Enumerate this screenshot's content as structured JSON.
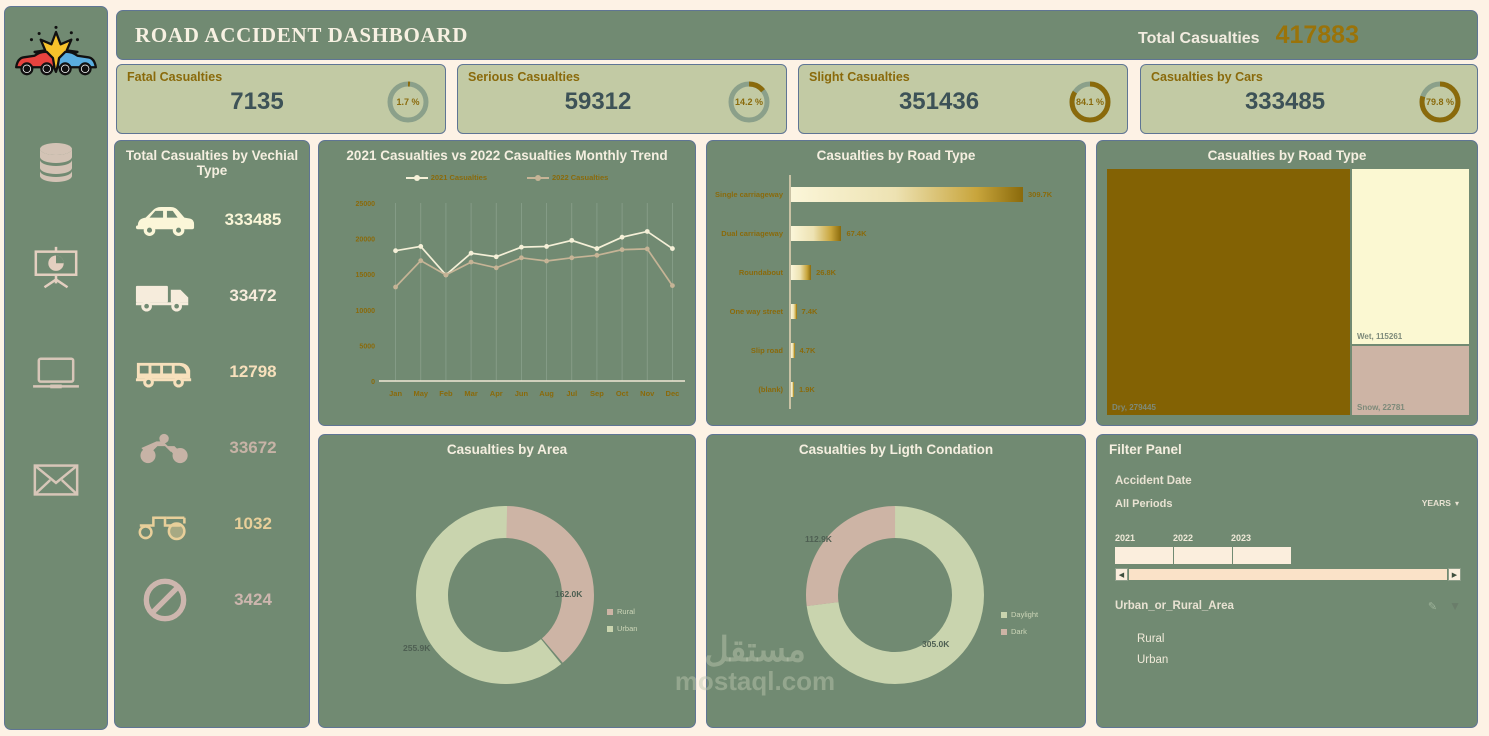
{
  "header": {
    "title": "ROAD ACCIDENT DASHBOARD",
    "total_label": "Total Casualties",
    "total_value": "417883"
  },
  "sidebar": {
    "icons": [
      {
        "name": "car-crash-logo",
        "label": "car-crash-logo"
      },
      {
        "name": "database-icon",
        "label": "database-icon"
      },
      {
        "name": "presentation-chart-icon",
        "label": "presentation-chart-icon"
      },
      {
        "name": "laptop-icon",
        "label": "laptop-icon"
      },
      {
        "name": "envelope-icon",
        "label": "envelope-icon"
      }
    ]
  },
  "kpis": [
    {
      "title": "Fatal Casualties",
      "value": "7135",
      "pct_label": "1.7 %",
      "pct": 1.7
    },
    {
      "title": "Serious Casualties",
      "value": "59312",
      "pct_label": "14.2 %",
      "pct": 14.2
    },
    {
      "title": "Slight Casualties",
      "value": "351436",
      "pct_label": "84.1 %",
      "pct": 84.1
    },
    {
      "title": "Casualties by Cars",
      "value": "333485",
      "pct_label": "79.8 %",
      "pct": 79.8
    }
  ],
  "vehicle_panel": {
    "title": "Total Casualties by Vechial Type",
    "rows": [
      {
        "icon": "car-icon",
        "value": "333485",
        "color": "#fbf6d8"
      },
      {
        "icon": "truck-icon",
        "value": "33472",
        "color": "#f6ecdc"
      },
      {
        "icon": "bus-icon",
        "value": "12798",
        "color": "#f7e0bc"
      },
      {
        "icon": "motorcycle-icon",
        "value": "33672",
        "color": "#c7b3a6"
      },
      {
        "icon": "tractor-icon",
        "value": "1032",
        "color": "#e8cf9a"
      },
      {
        "icon": "no-entry-icon",
        "value": "3424",
        "color": "#cdb6ae"
      }
    ]
  },
  "chart_data": [
    {
      "id": "monthly-trend",
      "type": "line",
      "title": "2021 Casualties vs 2022 Casualties Monthly Trend",
      "categories": [
        "Jan",
        "May",
        "Feb",
        "Mar",
        "Apr",
        "Jun",
        "Aug",
        "Jul",
        "Sep",
        "Oct",
        "Nov",
        "Dec"
      ],
      "series": [
        {
          "name": "2021 Casualties",
          "color": "#f5f0d8",
          "values": [
            18300,
            18900,
            14900,
            17950,
            17450,
            18800,
            18900,
            19750,
            18600,
            20200,
            21000,
            18600
          ]
        },
        {
          "name": "2022 Casualties",
          "color": "#c6b496",
          "values": [
            13200,
            16900,
            14900,
            16700,
            15900,
            17300,
            16850,
            17300,
            17650,
            18450,
            18550,
            13400
          ]
        }
      ],
      "ylabel": "",
      "xlabel": "",
      "yticks": [
        0,
        5000,
        10000,
        15000,
        20000,
        25000
      ],
      "ylim": [
        0,
        25000
      ],
      "grid": true,
      "legend_position": "top"
    },
    {
      "id": "road-type-bars",
      "type": "bar",
      "orientation": "horizontal",
      "title": "Casualties by Road Type",
      "categories": [
        "Single carriageway",
        "Dual carriageway",
        "Roundabout",
        "One way street",
        "Slip road",
        "(blank)"
      ],
      "values": [
        309700,
        67400,
        26800,
        7400,
        4700,
        1900
      ],
      "value_labels": [
        "309.7K",
        "67.4K",
        "26.8K",
        "7.4K",
        "4.7K",
        "1.9K"
      ],
      "xlim": [
        0,
        309700
      ],
      "grid": false
    },
    {
      "id": "road-surface-treemap",
      "type": "treemap",
      "title": "Casualties by Road Type",
      "categories": [
        "Dry",
        "Wet",
        "Snow"
      ],
      "values": [
        279445,
        115261,
        22781
      ],
      "labels": [
        "Dry, 279445",
        "Wet, 115261",
        "Snow, 22781"
      ],
      "colors": [
        "#836204",
        "#fbf8d2",
        "#cdb4a5"
      ]
    },
    {
      "id": "area-donut",
      "type": "pie",
      "title": "Casualties by Area",
      "categories": [
        "Rural",
        "Urban"
      ],
      "values": [
        162000,
        255900
      ],
      "value_labels": [
        "162.0K",
        "255.9K"
      ],
      "colors": [
        "#cdb4a5",
        "#c9d4ae"
      ],
      "legend_position": "right"
    },
    {
      "id": "light-donut",
      "type": "pie",
      "title": "Casualties by Ligth Condation",
      "categories": [
        "Daylight",
        "Dark"
      ],
      "values": [
        305000,
        112900
      ],
      "value_labels": [
        "305.0K",
        "112.9K"
      ],
      "colors": [
        "#c9d4ae",
        "#cdb4a5"
      ],
      "legend_position": "right"
    }
  ],
  "filter_panel": {
    "title": "Filter Panel",
    "date_label": "Accident Date",
    "period_label": "All Periods",
    "granularity": "YEARS",
    "years": [
      "2021",
      "2022",
      "2023"
    ],
    "field_label": "Urban_or_Rural_Area",
    "options": [
      "Rural",
      "Urban"
    ]
  },
  "watermark": {
    "line1": "مستقل",
    "line2": "mostaql.com"
  },
  "colors": {
    "page_bg": "#fdf2e5",
    "panel_bg": "#718a72",
    "panel_border": "#5f7594",
    "kpi_bg": "#c2caa4",
    "gold": "#8a6a0b",
    "cream": "#f5efe0",
    "slate": "#3d5257"
  }
}
